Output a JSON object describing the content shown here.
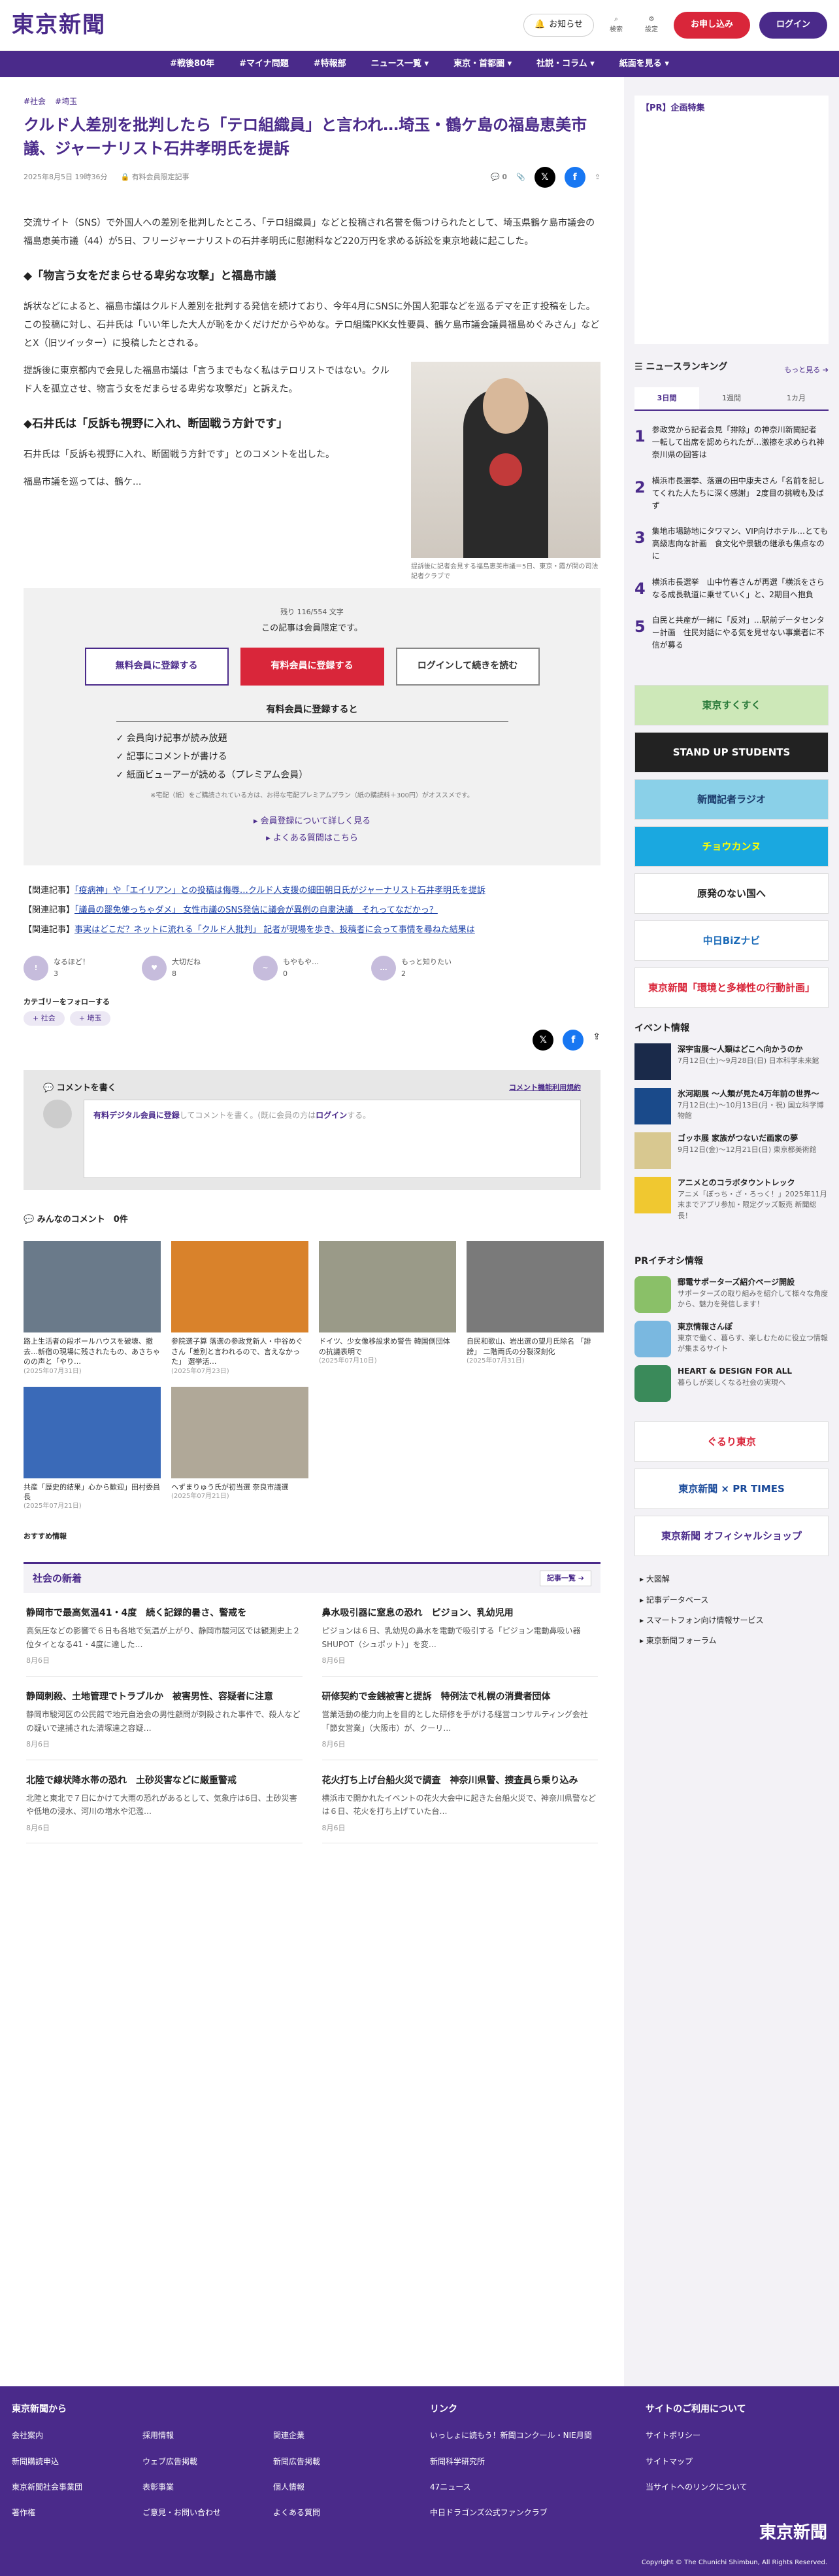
{
  "header": {
    "logo": "東京新聞",
    "notice": "お知らせ",
    "search": "検索",
    "settings": "設定",
    "register": "お申し込み",
    "login": "ログイン"
  },
  "nav": [
    "#戦後80年",
    "#マイナ問題",
    "#特報部",
    "ニュース一覧 ▾",
    "東京・首都圏 ▾",
    "社説・コラム ▾",
    "紙面を見る ▾"
  ],
  "article": {
    "tags": [
      "#社会",
      "#埼玉"
    ],
    "title": "クルド人差別を批判したら「テロ組織員」と言われ…埼玉・鶴ケ島の福島恵美市議、ジャーナリスト石井孝明氏を提訴",
    "date": "2025年8月5日 19時36分",
    "members": "有料会員限定記事",
    "comments": "0",
    "p1": "交流サイト（SNS）で外国人への差別を批判したところ、「テロ組織員」などと投稿され名誉を傷つけられたとして、埼玉県鶴ケ島市議会の福島恵美市議（44）が5日、フリージャーナリストの石井孝明氏に慰謝料など220万円を求める訴訟を東京地裁に起こした。",
    "h1": "◆「物言う女をだまらせる卑劣な攻撃」と福島市議",
    "p2": "訴状などによると、福島市議はクルド人差別を批判する発信を続けており、今年4月にSNSに外国人犯罪などを巡るデマを正す投稿をした。この投稿に対し、石井氏は「いい年した大人が恥をかくだけだからやめな。テロ組織PKK女性要員、鶴ケ島市議会議員福島めぐみさん」などとX（旧ツイッター）に投稿したとされる。",
    "p3": "提訴後に東京都内で会見した福島市議は「言うまでもなく私はテロリストではない。クルド人を孤立させ、物言う女をだまらせる卑劣な攻撃だ」と訴えた。",
    "h2": "◆石井氏は「反訴も視野に入れ、断固戦う方針です」",
    "p4": "石井氏は「反訴も視野に入れ、断固戦う方針です」とのコメントを出した。",
    "p5": "福島市議を巡っては、鶴ケ...",
    "caption": "提訴後に記者会見する福島恵美市議＝5日、東京・霞が関の司法記者クラブで"
  },
  "paywall": {
    "remain": "残り 116/554 文字",
    "limited": "この記事は会員限定です。",
    "free": "無料会員に登録する",
    "paid": "有料会員に登録する",
    "login": "ログインして続きを読む",
    "ben_title": "有料会員に登録すると",
    "b1": "✓ 会員向け記事が読み放題",
    "b2": "✓ 記事にコメントが書ける",
    "b3": "✓ 紙面ビューアーが読める（プレミアム会員）",
    "note": "※宅配（紙）をご購読されている方は、お得な宅配プレミアムプラン（紙の購読料＋300円）がオススメです。",
    "more": "▸ 会員登録について詳しく見る",
    "faq": "▸ よくある質問はこちら"
  },
  "related": [
    {
      "pre": "【関連記事】",
      "link": "「疫病神」や「エイリアン」との投稿は侮辱…クルド人支援の細田朝日氏がジャーナリスト石井孝明氏を提訴"
    },
    {
      "pre": "【関連記事】",
      "link": "「議員の罷免使っちゃダメ」 女性市議のSNS発信に議会が異例の自粛決議　それってなだかっ？"
    },
    {
      "pre": "【関連記事】",
      "link": "事実はどこだ？ネットに流れる「クルド人批判」 記者が現場を歩き、投稿者に会って事情を尋ねた結果は"
    }
  ],
  "reactions": [
    {
      "label": "なるほど！",
      "n": "3"
    },
    {
      "label": "大切だね",
      "n": "8"
    },
    {
      "label": "もやもや…",
      "n": "0"
    },
    {
      "label": "もっと知りたい",
      "n": "2"
    }
  ],
  "follow": {
    "title": "カテゴリーをフォローする",
    "chips": [
      "+ 社会",
      "+ 埼玉"
    ]
  },
  "comment": {
    "title": "コメントを書く",
    "rules": "コメント機能利用規約",
    "hint1": "有料デジタル会員に登録",
    "hint2": "してコメントを書く。(既に会員の方は",
    "hint3": "ログイン",
    "hint4": "する。"
  },
  "clist": {
    "title": "みんなのコメント",
    "count": "0件"
  },
  "thumbs": [
    {
      "t": "路上生活者の段ボールハウスを破壊、撤去…新宿の現場に残されたもの、あさちゃのの声と「やり…",
      "d": "(2025年07月31日)",
      "c": "#6a7a8a"
    },
    {
      "t": "参院選子算 落選の参政党新人・中谷めぐさん「差別と言われるので、言えなかった」 選挙活…",
      "d": "(2025年07月23日)",
      "c": "#d9822b"
    },
    {
      "t": "ドイツ、少女像移設求め警告 韓国側団体の抗議表明で",
      "d": "(2025年07月10日)",
      "c": "#9a9a88"
    },
    {
      "t": "自民和歌山、岩出選の望月氏除名 「誹謗」 二階両氏の分裂深刻化",
      "d": "(2025年07月31日)",
      "c": "#7a7a7a"
    },
    {
      "t": "共産「歴史的結果」心から歓迎」田村委員長",
      "d": "(2025年07月21日)",
      "c": "#3a6ab8"
    },
    {
      "t": "ヘずまりゅう氏が初当選 奈良市議選",
      "d": "(2025年07月21日)",
      "c": "#b0a898"
    }
  ],
  "osusume": "おすすめ情報",
  "shinchaku": {
    "title": "社会の新着",
    "more": "記事一覧 ➔",
    "items": [
      {
        "t": "静岡市で最高気温41・4度　続く記録的暑さ、警戒を",
        "s": "高気圧などの影響で６日も各地で気温が上がり、静岡市駿河区では観測史上２位タイとなる41・4度に達した…",
        "d": "8月6日"
      },
      {
        "t": "鼻水吸引器に窒息の恐れ　ピジョン、乳幼児用",
        "s": "ピジョンは６日、乳幼児の鼻水を電動で吸引する「ピジョン電動鼻吸い器　SHUPOT（シュポット）」を変…",
        "d": "8月6日"
      },
      {
        "t": "静岡刺殺、土地管理でトラブルか　被害男性、容疑者に注意",
        "s": "静岡市駿河区の公民館で地元自治会の男性顧問が刺殺された事件で、殺人などの疑いで逮捕された清塚達之容疑…",
        "d": "8月6日"
      },
      {
        "t": "研修契約で金銭被害と提訴　特例法で札幌の消費者団体",
        "s": "営業活動の能力向上を目的とした研修を手がける経営コンサルティング会社「節女営業」（大阪市）が、クーリ…",
        "d": "8月6日"
      },
      {
        "t": "北陸で線状降水帯の恐れ　土砂災害などに厳重警戒",
        "s": "北陸と東北で７日にかけて大雨の恐れがあるとして、気象庁は6日、土砂災害や低地の浸水、河川の増水や氾濫…",
        "d": "8月6日"
      },
      {
        "t": "花火打ち上げ台船火災で調査　神奈川県警、捜査員ら乗り込み",
        "s": "横浜市で開かれたイベントの花火大会中に起きた台船火災で、神奈川県警などは６日、花火を打ち上げていた台…",
        "d": "8月6日"
      }
    ]
  },
  "side": {
    "pr": "【PR】企画特集",
    "ranking": {
      "title": "ニュースランキング",
      "more": "もっと見る ➔",
      "tabs": [
        "3日間",
        "1週間",
        "1カ月"
      ],
      "items": [
        "参政党から記者会見「排除」の神奈川新聞記者　一転して出席を認められたが…激擦を求められ神奈川県の回答は",
        "横浜市長選挙、落選の田中康夫さん「名前を記してくれた人たちに深く感謝」 2度目の挑戦も及ばず",
        "集地市場跡地にタワマン、VIP向けホテル…とても高級志向な計画　食文化や景観の継承も焦点なのに",
        "横浜市長選挙　山中竹春さんが再選「横浜をさらなる成長軌道に乗せていく」と、2期目へ抱負",
        "自民と共産が一緒に「反対」…駅前データセンター計画　住民対話にやる気を見せない事業者に不信が募る"
      ]
    },
    "banners": [
      {
        "t": "東京すくすく",
        "bg": "#cde8b8",
        "c": "#2a7a3a"
      },
      {
        "t": "STAND UP STUDENTS",
        "bg": "#222",
        "c": "#fff"
      },
      {
        "t": "新聞記者ラジオ",
        "bg": "#8ad0e8",
        "c": "#1a3a6a"
      },
      {
        "t": "チョウカンヌ",
        "bg": "#1aa8e0",
        "c": "#ff0"
      },
      {
        "t": "原発のない国へ",
        "bg": "#fff",
        "c": "#222"
      },
      {
        "t": "中日BiZナビ",
        "bg": "#fff",
        "c": "#1a6ab8"
      },
      {
        "t": "東京新聞「環境と多様性の行動計画」",
        "bg": "#fff",
        "c": "#d9263a"
      }
    ],
    "events_title": "イベント情報",
    "events": [
      {
        "t": "深宇宙展〜人類はどこへ向かうのか",
        "s": "7月12日(土)〜9月28日(日) 日本科学未来館",
        "c": "#1a2a4a"
      },
      {
        "t": "氷河期展 〜人類が見た4万年前の世界〜",
        "s": "7月12日(土)〜10月13日(月・祝) 国立科学博物館",
        "c": "#1a4a8a"
      },
      {
        "t": "ゴッホ展 家族がつないだ画家の夢",
        "s": "9月12日(金)〜12月21日(日) 東京都美術館",
        "c": "#d8c890"
      },
      {
        "t": "アニメとのコラボタウントレック",
        "s": "アニメ「ぽっち・ざ・ろっく！」2025年11月末までアプリ参加・限定グッズ販売 新聞総長！",
        "c": "#f0c830"
      }
    ],
    "pr_title": "PRイチオシ情報",
    "pr_items": [
      {
        "t": "郵電サポーターズ紹介ページ開設",
        "s": "サポーターズの取り組みを紹介して様々な角度から、魅力を発信します！",
        "c": "#8ac068"
      },
      {
        "t": "東京情報さんぽ",
        "s": "東京で働く、暮らす、楽しむために役立つ情報が集まるサイト",
        "c": "#7ab8e0"
      },
      {
        "t": "HEART & DESIGN FOR ALL",
        "s": "暮らしが楽しくなる社会の実現へ",
        "c": "#3a8a5a"
      }
    ],
    "banners2": [
      {
        "t": "ぐるり東京",
        "bg": "#fff",
        "c": "#d9263a"
      },
      {
        "t": "東京新聞 × PR TIMES",
        "bg": "#fff",
        "c": "#1a4a9a"
      },
      {
        "t": "東京新聞 オフィシャルショップ",
        "bg": "#fff",
        "c": "#4a2a8a"
      }
    ],
    "links": [
      "▸ 大図解",
      "▸ 記事データベース",
      "▸ スマートフォン向け情報サービス",
      "▸ 東京新聞フォーラム"
    ]
  },
  "footer": {
    "c1": "東京新聞から",
    "c2": "リンク",
    "c3": "サイトのご利用について",
    "logo": "東京新聞",
    "l1": [
      "会社案内",
      "採用情報",
      "関連企業",
      "新聞購読申込",
      "ウェブ広告掲載",
      "新聞広告掲載",
      "東京新聞社会事業団",
      "表彰事業",
      "個人情報",
      "著作権",
      "ご意見・お問い合わせ",
      "よくある質問"
    ],
    "l2": [
      "いっしょに読もう！新聞コンクール・NIE月間",
      "新聞科学研究所",
      "47ニュース",
      "中日ドラゴンズ公式ファンクラブ"
    ],
    "l3": [
      "サイトポリシー",
      "サイトマップ",
      "当サイトへのリンクについて"
    ],
    "copy": "Copyright © The Chunichi Shimbun, All Rights Reserved."
  },
  "colors": {
    "brand": "#4a2a8a",
    "accent": "#d9263a"
  }
}
